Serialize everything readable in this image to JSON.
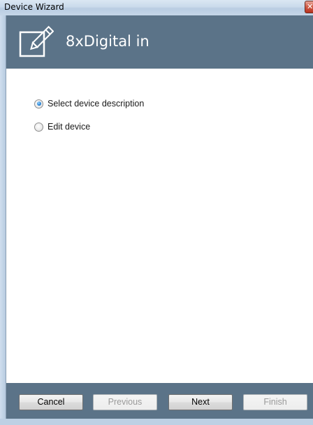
{
  "window": {
    "title": "Device Wizard",
    "close_glyph": "✕"
  },
  "header": {
    "icon": "edit-icon",
    "title": "8xDigital in",
    "color": "#5b7388"
  },
  "options": [
    {
      "label": "Select device description",
      "selected": true
    },
    {
      "label": "Edit device",
      "selected": false
    }
  ],
  "footer": {
    "buttons": [
      {
        "label": "Cancel",
        "enabled": true
      },
      {
        "label": "Previous",
        "enabled": false
      },
      {
        "label": "Next",
        "enabled": true
      },
      {
        "label": "Finish",
        "enabled": false
      }
    ]
  },
  "colors": {
    "banner": "#5b7388",
    "radio_selected": "#2b86d6"
  }
}
